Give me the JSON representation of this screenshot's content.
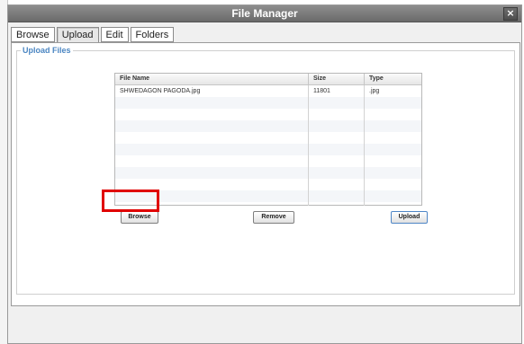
{
  "window": {
    "title": "File Manager",
    "close_label": "×"
  },
  "tabs": [
    {
      "label": "Browse"
    },
    {
      "label": "Upload",
      "active": true
    },
    {
      "label": "Edit"
    },
    {
      "label": "Folders"
    }
  ],
  "upload_panel": {
    "legend": "Upload Files"
  },
  "file_table": {
    "columns": [
      "File Name",
      "Size",
      "Type"
    ],
    "rows": [
      {
        "name": "SHWEDAGON PAGODA.jpg",
        "size": "11801",
        "type": ".jpg"
      }
    ]
  },
  "buttons": {
    "browse": "Browse",
    "remove": "Remove",
    "upload": "Upload"
  },
  "colors": {
    "legend": "#4b86c2",
    "highlight": "#e00000"
  }
}
